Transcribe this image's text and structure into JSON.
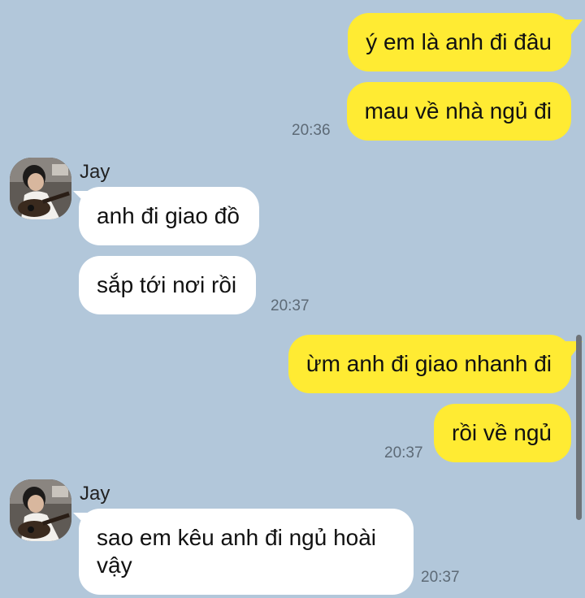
{
  "messages": [
    {
      "side": "out",
      "text": "ý em là anh đi đâu"
    },
    {
      "side": "out",
      "text": "mau về nhà ngủ đi",
      "time": "20:36"
    },
    {
      "side": "in",
      "sender": "Jay",
      "text": "anh đi giao đồ"
    },
    {
      "side": "in",
      "text": "sắp tới nơi rồi",
      "time": "20:37"
    },
    {
      "side": "out",
      "text": "ừm anh đi giao nhanh đi"
    },
    {
      "side": "out",
      "text": "rồi về ngủ",
      "time": "20:37"
    },
    {
      "side": "in",
      "sender": "Jay",
      "text": "sao em kêu anh đi ngủ hoài vậy",
      "time": "20:37"
    }
  ],
  "colors": {
    "background": "#b2c7da",
    "outgoing_bubble": "#ffeb33",
    "incoming_bubble": "#ffffff",
    "timestamp": "#5d6a76"
  },
  "icons": {
    "avatar": "profile-photo-man-with-guitar"
  }
}
